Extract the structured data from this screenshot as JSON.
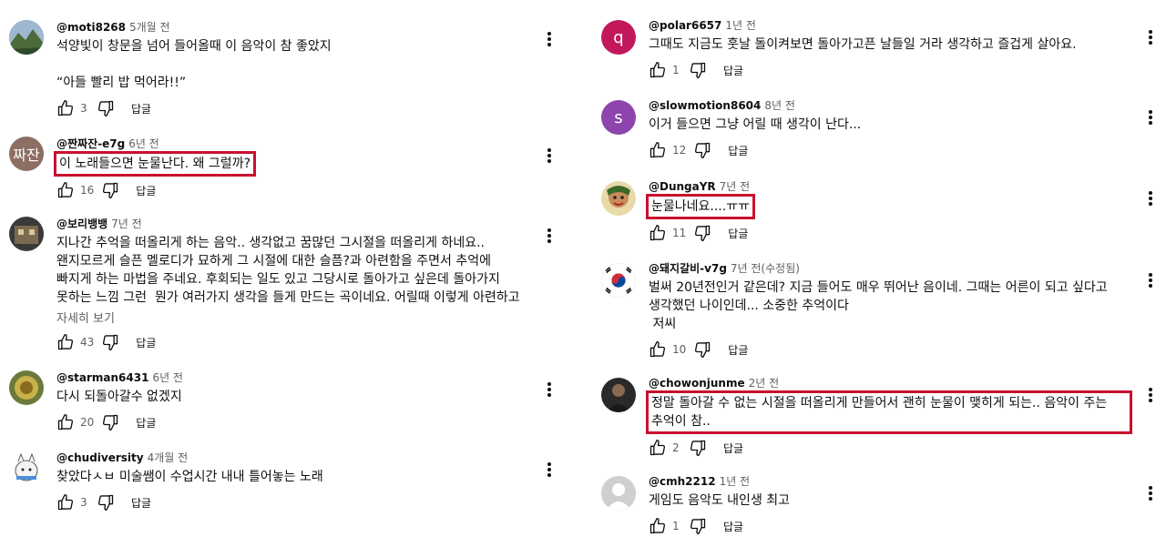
{
  "left": [
    {
      "handle": "@moti8268",
      "time": "5개월 전",
      "text": "석양빛이 창문을 넘어 들어올때 이 음악이 참 좋았지\n\n“아들 빨리 밥 먹어라!!”",
      "likes": "3",
      "reply": "답글"
    },
    {
      "handle": "@짠짜잔-e7g",
      "time": "6년 전",
      "avatar_text": "짜잔",
      "text": "이 노래들으면 눈물난다. 왜 그럴까?",
      "likes": "16",
      "reply": "답글"
    },
    {
      "handle": "@보리뱅뱅",
      "time": "7년 전",
      "text": "지나간 추억을 떠올리게 하는 음악.. 생각없고 꿈많던 그시절을 떠올리게 하네요.. 왠지모르게 슬픈 멜로디가 묘하게 그 시절에 대한 슬픔?과 아련함을 주면서 추억에 빠지게 하는 마법을 주네요. 후회되는 일도 있고 그당시로 돌아가고 싶은데 돌아가지 못하는 느낌 그런  뭔가 여러가지 생각을 들게 만드는 곡이네요. 어릴때 이렇게 아련하고 슬픈노래를 들었었다..",
      "more": "자세히 보기",
      "likes": "43",
      "reply": "답글"
    },
    {
      "handle": "@starman6431",
      "time": "6년 전",
      "text": "다시 되돌아갈수 없겠지",
      "likes": "20",
      "reply": "답글"
    },
    {
      "handle": "@chudiversity",
      "time": "4개월 전",
      "text": "찾았다ㅅㅂ 미술쌤이 수업시간 내내 틀어놓는 노래",
      "likes": "3",
      "reply": "답글"
    }
  ],
  "right": [
    {
      "handle": "@polar6657",
      "time": "1년 전",
      "avatar_text": "q",
      "text": "그때도 지금도 훗날 돌이켜보면 돌아가고픈 날들일 거라 생각하고 즐겁게 살아요.",
      "likes": "1",
      "reply": "답글"
    },
    {
      "handle": "@slowmotion8604",
      "time": "8년 전",
      "avatar_text": "s",
      "text": "이거 들으면 그냥 어릴 때 생각이 난다...",
      "likes": "12",
      "reply": "답글"
    },
    {
      "handle": "@DungaYR",
      "time": "7년 전",
      "text": "눈물나네요....ㅠㅠ",
      "likes": "11",
      "reply": "답글"
    },
    {
      "handle": "@돼지갈비-v7g",
      "time": "7년 전(수정됨)",
      "text": "벌써 20년전인거 같은데? 지금 들어도 매우 뛰어난 음이네. 그때는 어른이 되고 싶다고 생각했던 나이인데... 소중한 추억이다\n 저씨",
      "likes": "10",
      "reply": "답글"
    },
    {
      "handle": "@chowonjunme",
      "time": "2년 전",
      "text": "정말 돌아갈 수 없는 시절을 떠올리게 만들어서 괜히 눈물이 맺히게 되는.. 음악이 주는 추억이 참..",
      "likes": "2",
      "reply": "답글"
    },
    {
      "handle": "@cmh2212",
      "time": "1년 전",
      "text": "게임도 음악도 내인생 최고",
      "likes": "1",
      "reply": "답글"
    }
  ],
  "colors": {
    "highlight": "#c8102e",
    "avatar_polar": "#c2185b",
    "avatar_slow": "#8e44ad",
    "avatar_jjajan": "#8d6e63"
  }
}
